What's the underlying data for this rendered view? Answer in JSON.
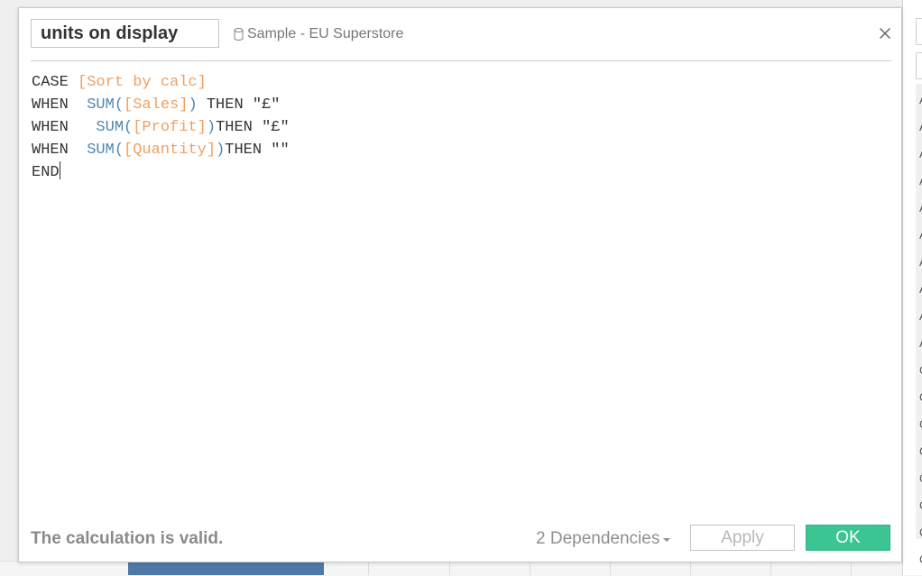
{
  "dialog": {
    "calc_name": "units on display",
    "datasource_label": "Sample - EU Superstore",
    "status": "The calculation is valid.",
    "dependencies_label": "2 Dependencies",
    "apply_label": "Apply",
    "ok_label": "OK"
  },
  "code": {
    "line1": {
      "kw": "CASE",
      "field": "[Sort by calc]"
    },
    "line2": {
      "kw": "WHEN",
      "fn": "SUM",
      "open": "(",
      "field": "[Sales]",
      "close": ")",
      "then": "THEN",
      "str": "\"£\""
    },
    "line3": {
      "kw": "WHEN",
      "fn": "SUM",
      "open": "(",
      "field": "[Profit]",
      "close": ")",
      "then": "THEN",
      "str": "\"£\""
    },
    "line4": {
      "kw": "WHEN",
      "fn": "SUM",
      "open": "(",
      "field": "[Quantity]",
      "close": ")",
      "then": "THEN",
      "str": "\"\""
    },
    "line5": {
      "kw": "END"
    }
  },
  "colors": {
    "ok_green": "#3cc492",
    "field_orange": "#f0a060",
    "function_blue": "#4f86b0",
    "bar_blue": "#4e79a7"
  },
  "right_panel": {
    "items": [
      "A",
      "A",
      "A",
      "A",
      "A",
      "A",
      "A",
      "A",
      "A",
      "A",
      "C",
      "C",
      "C",
      "C",
      "C",
      "C",
      "C",
      "C"
    ]
  }
}
